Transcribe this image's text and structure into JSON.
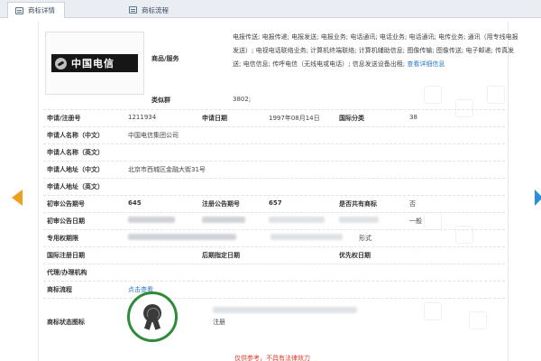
{
  "tabs": [
    {
      "label": "商标详情",
      "active": true
    },
    {
      "label": "商标流程",
      "active": false
    }
  ],
  "logo": {
    "text": "中国电信"
  },
  "goods": {
    "label": "商品/服务",
    "text": "电报传送; 电报传递; 电报发送; 电报业务; 电话通讯; 电话业务; 电话通讯; 电传业务; 通讯（用专线电报发送）; 电视电话联络业务; 计算机终端联络; 计算机辅助信息; 图像传输; 图像传送; 电子邮递; 传真发送; 电信信息; 传呼电信（无线电或电话）; 信息发送设备出租;",
    "more_link": "查看详细信息"
  },
  "class_group": {
    "label": "类似群",
    "value": "3802;"
  },
  "fields": {
    "reg_no_label": "申请/注册号",
    "reg_no": "1211934",
    "app_date_label": "申请日期",
    "app_date": "1997年08月14日",
    "intl_class_label": "国际分类",
    "intl_class": "38",
    "applicant_cn_label": "申请人名称（中文）",
    "applicant_cn": "中国电信集团公司",
    "applicant_en_label": "申请人名称（英文）",
    "address_cn_label": "申请人地址（中文）",
    "address_cn": "北京市西城区金融大街31号",
    "address_en_label": "申请人地址（英文）",
    "first_pub_no_label": "初审公告期号",
    "first_pub_no": "645",
    "reg_pub_no_label": "注册公告期号",
    "reg_pub_no": "657",
    "shared_label": "是否共有商标",
    "shared": "否",
    "first_pub_date_label": "初审公告日期",
    "type_value": "一般",
    "exclusive_period_label": "专用权期限",
    "form_value": "形式",
    "intl_reg_date_label": "国际注册日期",
    "later_date_label": "后期指定日期",
    "priority_date_label": "优先权日期",
    "agent_label": "代理/办理机构",
    "process_label": "商标流程",
    "process_link": "点击查看",
    "status_label": "商标状态图标",
    "status_note": "注册"
  },
  "footer": {
    "note": "仅供参考，不具有法律效力"
  },
  "colors": {
    "accent": "#2a78c8",
    "seal": "#2e8b3a",
    "warning": "#e03a2a",
    "prev_arrow": "#f0a020",
    "next_arrow": "#2c8fd8"
  }
}
